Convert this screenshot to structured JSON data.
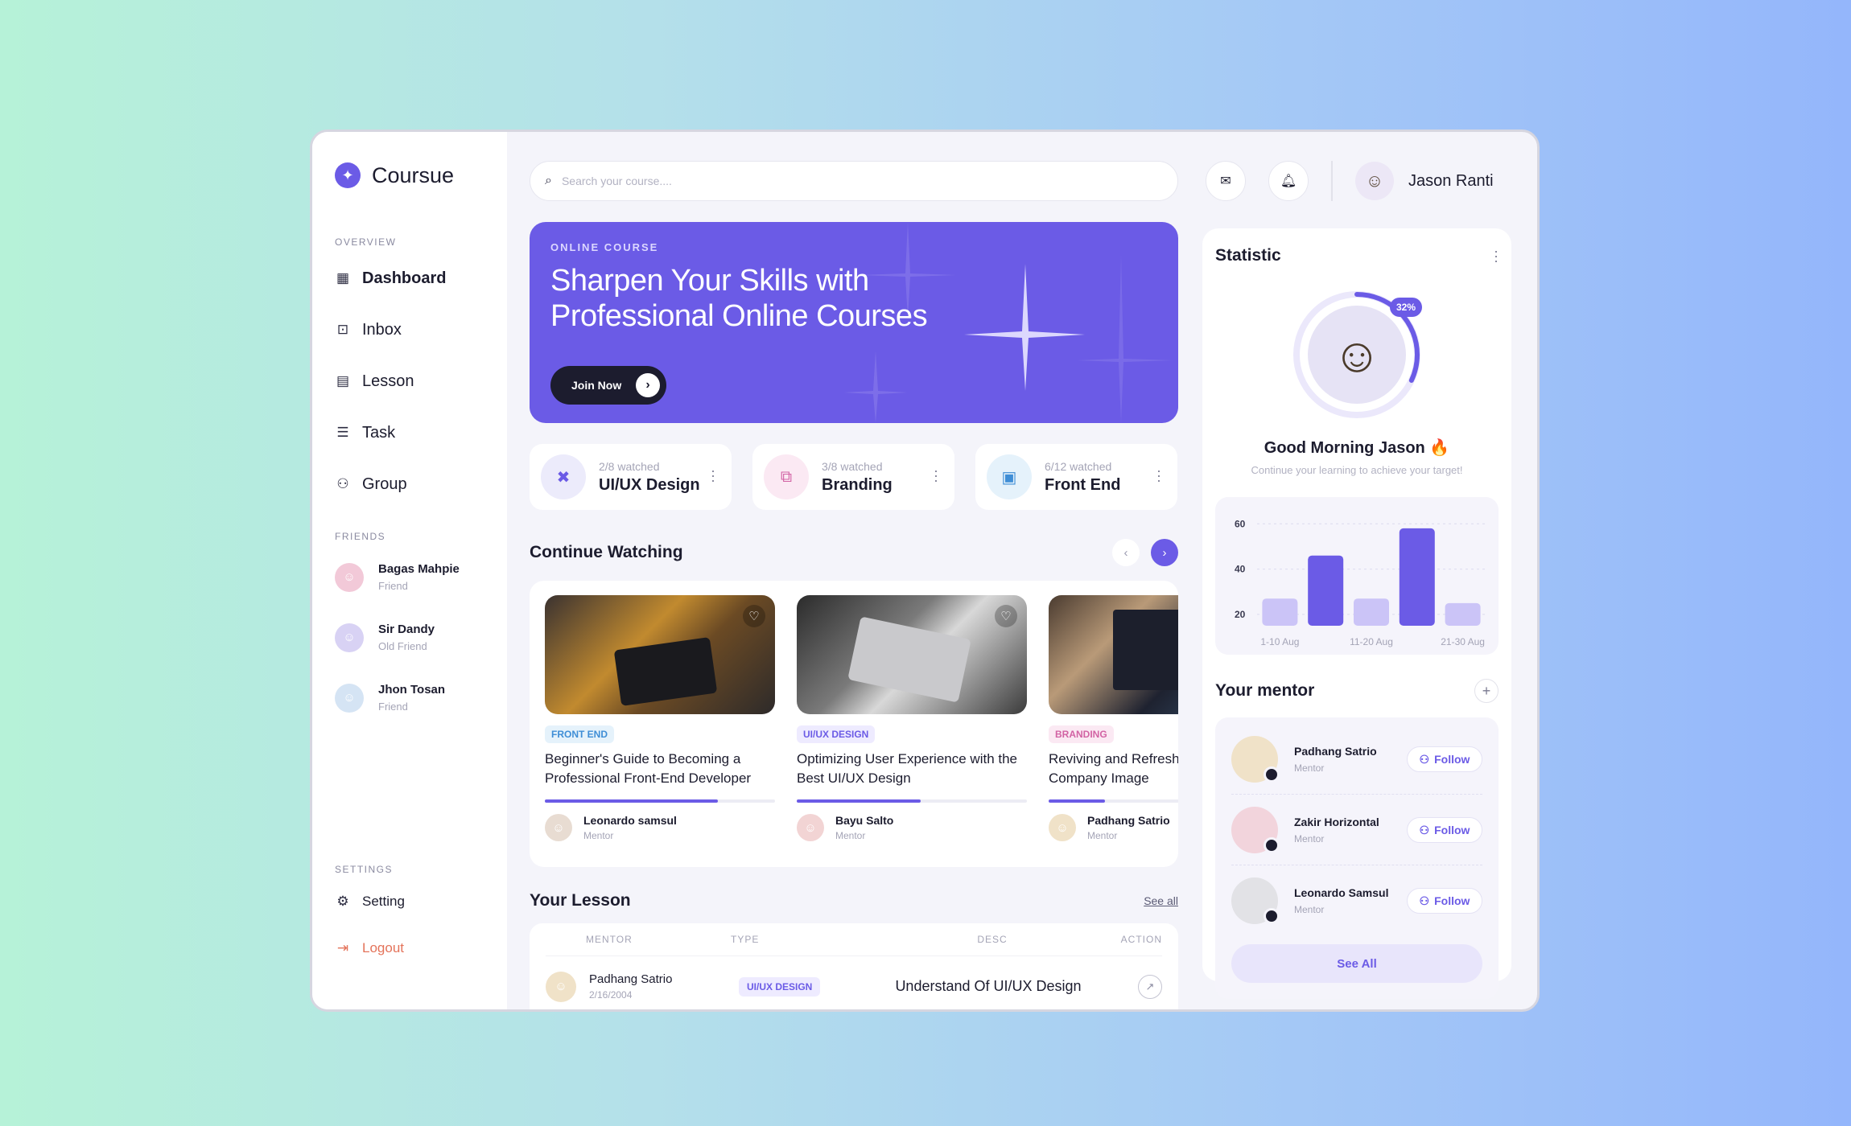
{
  "app": {
    "name": "Coursue"
  },
  "sidebar": {
    "overview_label": "OVERVIEW",
    "nav": [
      {
        "label": "Dashboard",
        "icon": "dashboard-icon"
      },
      {
        "label": "Inbox",
        "icon": "inbox-icon"
      },
      {
        "label": "Lesson",
        "icon": "lesson-icon"
      },
      {
        "label": "Task",
        "icon": "task-icon"
      },
      {
        "label": "Group",
        "icon": "group-icon"
      }
    ],
    "friends_label": "FRIENDS",
    "friends": [
      {
        "name": "Bagas Mahpie",
        "relation": "Friend"
      },
      {
        "name": "Sir Dandy",
        "relation": "Old Friend"
      },
      {
        "name": "Jhon Tosan",
        "relation": "Friend"
      }
    ],
    "settings_label": "SETTINGS",
    "setting": "Setting",
    "logout": "Logout"
  },
  "search": {
    "placeholder": "Search your course...."
  },
  "user": {
    "name": "Jason Ranti"
  },
  "hero": {
    "eyebrow": "ONLINE COURSE",
    "title": "Sharpen Your Skills with Professional Online Courses",
    "cta": "Join Now"
  },
  "categories": [
    {
      "watched": "2/8 watched",
      "name": "UI/UX Design",
      "icon": "design-icon"
    },
    {
      "watched": "3/8 watched",
      "name": "Branding",
      "icon": "branding-icon"
    },
    {
      "watched": "6/12 watched",
      "name": "Front End",
      "icon": "frontend-icon"
    }
  ],
  "continue": {
    "title": "Continue Watching",
    "videos": [
      {
        "tag": "FRONT END",
        "title": "Beginner's Guide to Becoming a Professional Front-End Developer",
        "progress": 0.75,
        "mentor": "Leonardo samsul",
        "role": "Mentor"
      },
      {
        "tag": "UI/UX DESIGN",
        "title": "Optimizing User Experience with the Best UI/UX Design",
        "progress": 0.54,
        "mentor": "Bayu Salto",
        "role": "Mentor"
      },
      {
        "tag": "BRANDING",
        "title": "Reviving and Refresh Company Image",
        "progress": 0.35,
        "mentor": "Padhang Satrio",
        "role": "Mentor"
      }
    ]
  },
  "lesson": {
    "title": "Your Lesson",
    "see_all": "See all",
    "columns": [
      "MENTOR",
      "TYPE",
      "DESC",
      "ACTION"
    ],
    "rows": [
      {
        "mentor": "Padhang Satrio",
        "date": "2/16/2004",
        "type": "UI/UX DESIGN",
        "desc": "Understand Of UI/UX Design"
      }
    ]
  },
  "statistic": {
    "title": "Statistic",
    "percent": "32%",
    "percent_value": 0.32,
    "greeting": "Good Morning Jason 🔥",
    "subtitle": "Continue your learning to achieve your target!"
  },
  "chart_data": {
    "type": "bar",
    "categories": [
      "1-10 Aug",
      "11-20 Aug",
      "21-30 Aug"
    ],
    "series": [
      {
        "values": [
          27,
          46,
          27,
          58,
          25
        ]
      }
    ],
    "xlabels": [
      "1-10 Aug",
      "11-20 Aug",
      "21-30 Aug"
    ],
    "yticks": [
      20,
      40,
      60
    ],
    "ylim": [
      15,
      64
    ],
    "grid": true
  },
  "mentors": {
    "title": "Your mentor",
    "list": [
      {
        "name": "Padhang Satrio",
        "role": "Mentor",
        "action": "Follow"
      },
      {
        "name": "Zakir Horizontal",
        "role": "Mentor",
        "action": "Follow"
      },
      {
        "name": "Leonardo Samsul",
        "role": "Mentor",
        "action": "Follow"
      }
    ],
    "see_all": "See All"
  },
  "colors": {
    "accent": "#6b5be6",
    "accent_light": "#cbc4f7"
  }
}
